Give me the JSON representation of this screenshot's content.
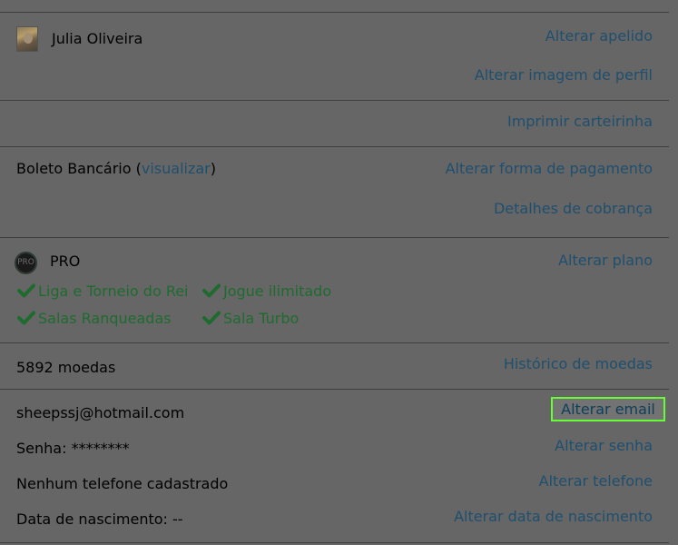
{
  "profile": {
    "name": "Julia Oliveira",
    "change_nickname": "Alterar apelido",
    "change_picture": "Alterar imagem de perfil"
  },
  "card": {
    "print_card": "Imprimir carteirinha"
  },
  "payment": {
    "method_prefix": "Boleto Bancário (",
    "view_link": "visualizar",
    "method_suffix": ")",
    "change_payment": "Alterar forma de pagamento",
    "billing_details": "Detalhes de cobrança"
  },
  "plan": {
    "badge_text": "PRO",
    "name": "PRO",
    "change_plan": "Alterar plano",
    "features": [
      "Liga e Torneio do Rei",
      "Jogue ilimitado",
      "Salas Ranqueadas",
      "Sala Turbo"
    ]
  },
  "coins": {
    "amount": "5892 moedas",
    "history": "Histórico de moedas"
  },
  "account": {
    "email": "sheepssj@hotmail.com",
    "change_email": "Alterar email",
    "password": "Senha: ********",
    "change_password": "Alterar senha",
    "phone": "Nenhum telefone cadastrado",
    "change_phone": "Alterar telefone",
    "birthdate": "Data de nascimento: --",
    "change_birthdate": "Alterar data de nascimento"
  },
  "colors": {
    "overlay_background": "#666666",
    "link": "#1f4f6e",
    "feature_green": "#1f6b2f",
    "focus_outline": "#66ff33"
  }
}
